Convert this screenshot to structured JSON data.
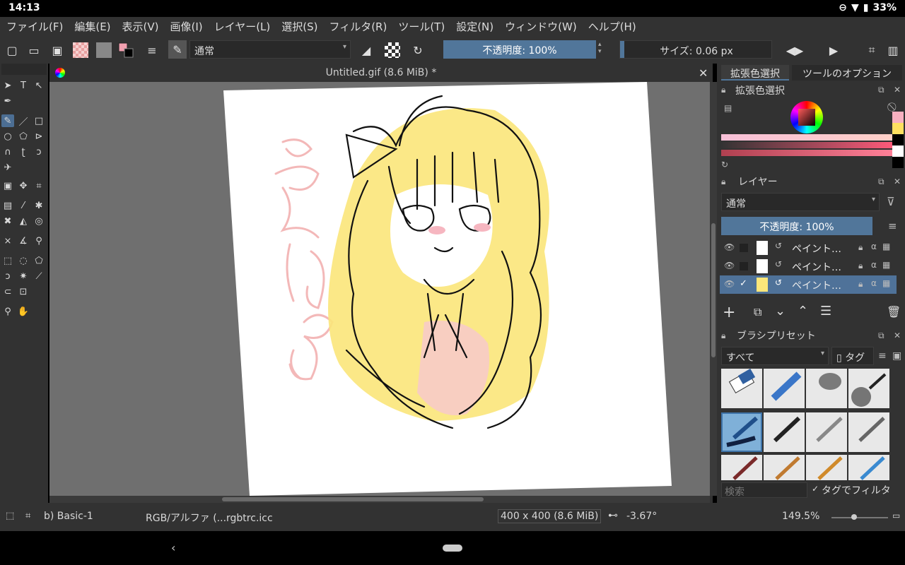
{
  "status": {
    "time": "14:13",
    "battery": "33%"
  },
  "menu": [
    "ファイル(F)",
    "編集(E)",
    "表示(V)",
    "画像(I)",
    "レイヤー(L)",
    "選択(S)",
    "フィルタ(R)",
    "ツール(T)",
    "設定(N)",
    "ウィンドウ(W)",
    "ヘルプ(H)"
  ],
  "toolbar": {
    "blend_mode": "通常",
    "opacity": "不透明度: 100%",
    "size": "サイズ: 0.06 px"
  },
  "document": {
    "title": "Untitled.gif (8.6 MiB) *"
  },
  "docker": {
    "tabs": [
      "拡張色選択",
      "ツールのオプション"
    ],
    "color_panel_title": "拡張色選択",
    "layers_title": "レイヤー",
    "layer_blend": "通常",
    "layer_opacity": "不透明度: 100%",
    "layers": [
      {
        "name": "ペイント…",
        "selected": false,
        "checked": false
      },
      {
        "name": "ペイント…",
        "selected": false,
        "checked": false
      },
      {
        "name": "ペイント…",
        "selected": true,
        "checked": true
      }
    ],
    "brush_title": "ブラシプリセット",
    "brush_filter": "すべて",
    "brush_tag": "タグ",
    "search_placeholder": "検索",
    "tag_filter_label": "タグでフィルタ"
  },
  "bottom": {
    "brush_name": "b) Basic-1",
    "color_profile": "RGB/アルファ (...rgbtrc.icc",
    "image_size": "400 x 400 (8.6 MiB)",
    "rotation": "-3.67°",
    "zoom": "149.5%"
  },
  "colors": {
    "accent": "#51769a",
    "bg": "#323232",
    "canvas_bg": "#6f6f6f"
  }
}
